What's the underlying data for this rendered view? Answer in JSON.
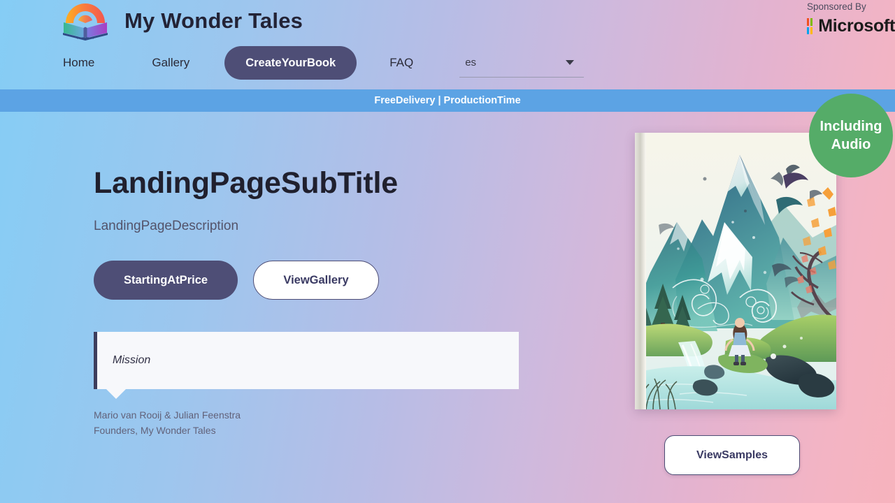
{
  "site": {
    "brand_title": "My Wonder Tales",
    "logo_icon": "rainbow-open-book-icon"
  },
  "header": {
    "nav": [
      {
        "label": "Home",
        "name": "home"
      },
      {
        "label": "Gallery",
        "name": "gallery"
      },
      {
        "label": "FAQ",
        "name": "faq"
      }
    ],
    "create_button_label": "CreateYourBook",
    "language_select": {
      "value": "es",
      "caret_icon": "chevron-down-icon"
    },
    "sponsor": {
      "label": "Sponsored By",
      "logo_icon": "microsoft-logo-icon",
      "name": "Microsoft"
    }
  },
  "promo_banner": {
    "text": "FreeDelivery | ProductionTime",
    "background": "#5ca3e4"
  },
  "hero": {
    "title": "LandingPageSubTitle",
    "description": "LandingPageDescription",
    "primary_button_label": "StartingAtPrice",
    "secondary_button_label": "ViewGallery",
    "quote": {
      "text": "Mission",
      "author_name": "Mario van Rooij & Julian Feenstra",
      "author_role": "Founders, My Wonder Tales"
    }
  },
  "showcase": {
    "audio_badge_line1": "Including",
    "audio_badge_line2": "Audio",
    "audio_badge_color": "#55ac68",
    "book_cover_alt": "fantasy-book-cover-mountain-girl-waterfall",
    "samples_button_label": "ViewSamples"
  },
  "theme": {
    "accent_dark": "#4e4e76",
    "banner_blue": "#5ca3e4",
    "badge_green": "#55ac68",
    "bg_gradient_start": "#85cdf5",
    "bg_gradient_end": "#f7b3bd"
  }
}
